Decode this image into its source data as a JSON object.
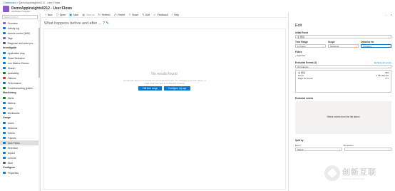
{
  "breadcrumb": {
    "root": "Dashboard",
    "separator": ">",
    "current": "DemoAppInsights0212 - User Flows"
  },
  "title": "DemoAppInsights0212 - User Flows",
  "subtitle": "Application Insights",
  "sidebar": {
    "search_placeholder": "Search (Ctrl+/)",
    "top_items": [
      {
        "label": "Overview",
        "icon_color": "#8a5dc8"
      },
      {
        "label": "Activity log",
        "icon_color": "#0078d4"
      },
      {
        "label": "Access control (IAM)",
        "icon_color": "#0078d4"
      },
      {
        "label": "Tags",
        "icon_color": "#8a5dc8"
      },
      {
        "label": "Diagnose and solve pro...",
        "icon_color": "#605e5c"
      }
    ],
    "investigate_label": "Investigate",
    "investigate_items": [
      {
        "label": "Application map",
        "icon_color": "#0078d4"
      },
      {
        "label": "Smart Detection",
        "icon_color": "#0078d4"
      },
      {
        "label": "Live Metrics Stream",
        "icon_color": "#0078d4"
      },
      {
        "label": "Search",
        "icon_color": "#0078d4"
      },
      {
        "label": "Availability",
        "icon_color": "#107c10"
      },
      {
        "label": "Failures",
        "icon_color": "#d13438"
      },
      {
        "label": "Performance",
        "icon_color": "#0078d4"
      },
      {
        "label": "Troubleshooting guides...",
        "icon_color": "#107c10"
      }
    ],
    "monitoring_label": "Monitoring",
    "monitoring_items": [
      {
        "label": "Alerts",
        "icon_color": "#107c10"
      },
      {
        "label": "Metrics",
        "icon_color": "#0078d4"
      },
      {
        "label": "Logs",
        "icon_color": "#0078d4"
      },
      {
        "label": "Workbooks",
        "icon_color": "#0078d4"
      }
    ],
    "usage_label": "Usage",
    "usage_items": [
      {
        "label": "Users",
        "icon_color": "#0078d4"
      },
      {
        "label": "Sessions",
        "icon_color": "#0078d4"
      },
      {
        "label": "Events",
        "icon_color": "#0078d4"
      },
      {
        "label": "Funnels",
        "icon_color": "#0078d4"
      },
      {
        "label": "User Flows",
        "icon_color": "#0078d4"
      },
      {
        "label": "Retention",
        "icon_color": "#0078d4"
      },
      {
        "label": "Impact",
        "icon_color": "#0078d4"
      },
      {
        "label": "Cohorts",
        "icon_color": "#0078d4"
      },
      {
        "label": "More",
        "icon_color": "#605e5c"
      }
    ],
    "configure_label": "Configure",
    "configure_items": [
      {
        "label": "Properties",
        "icon_color": "#0078d4"
      }
    ],
    "active_item": "User Flows"
  },
  "toolbar": {
    "items": [
      {
        "glyph": "+",
        "label": "New",
        "disabled": false
      },
      {
        "glyph": "▢",
        "label": "Open",
        "disabled": false
      },
      {
        "glyph": "▣",
        "label": "Save",
        "disabled": false
      },
      {
        "glyph": "▣",
        "label": "Save as",
        "disabled": true
      },
      {
        "glyph": "↻",
        "label": "Refresh",
        "disabled": false
      },
      {
        "glyph": "⤺",
        "label": "Revert",
        "disabled": false
      },
      {
        "glyph": "⇪",
        "label": "Share",
        "disabled": false
      },
      {
        "glyph": "✎",
        "label": "Edit",
        "disabled": false
      },
      {
        "glyph": "☺",
        "label": "Feedback",
        "disabled": false
      },
      {
        "glyph": "?",
        "label": "Help",
        "disabled": false
      }
    ]
  },
  "main": {
    "question": "What happens before and after ... ?",
    "edit_glyph": "✎",
    "no_results_title": "No results found",
    "no_results_body": "It looks like there is no activity for your selected event. Try changing your time range, or make sure your app is configured correctly.",
    "edit_time_range_label": "Edit time range",
    "configure_app_label": "Configure my app"
  },
  "panel": {
    "header_icons": [
      "…",
      "×"
    ],
    "title": "Edit",
    "initial_event_label": "Initial Event",
    "initial_event_value": "业 测试",
    "time_range_label": "Time Range",
    "time_range_value": "12 hours",
    "scope_label": "Scope",
    "scope_value": "Sessions",
    "optimize_label": "Optimize for",
    "optimize_value": "Accuracy",
    "filters_label": "Filters",
    "add_filter_label": "+ Add filter",
    "excluded_events_label": "Excluded Events (2)",
    "exclude_all_link": "Exclude all events",
    "excluded_dropdown_value": "All requests",
    "event_list": [
      {
        "name": "业 测试",
        "count": "999"
      },
      {
        "name": "Home",
        "count": "1,461,461.40"
      },
      {
        "name": "Page not found",
        "count": "777"
      }
    ],
    "excluded_events_section_label": "Excluded events",
    "select_events_message": "Select events from the list above",
    "split_by_label": "Split by",
    "split_event_col": "Event",
    "split_dimension_col": "Dimension",
    "split_event_value": "Select...",
    "split_dimension_value": ""
  },
  "watermark": {
    "brand": "创新互联",
    "sub": "CHUANG XIN HU LIAN"
  }
}
